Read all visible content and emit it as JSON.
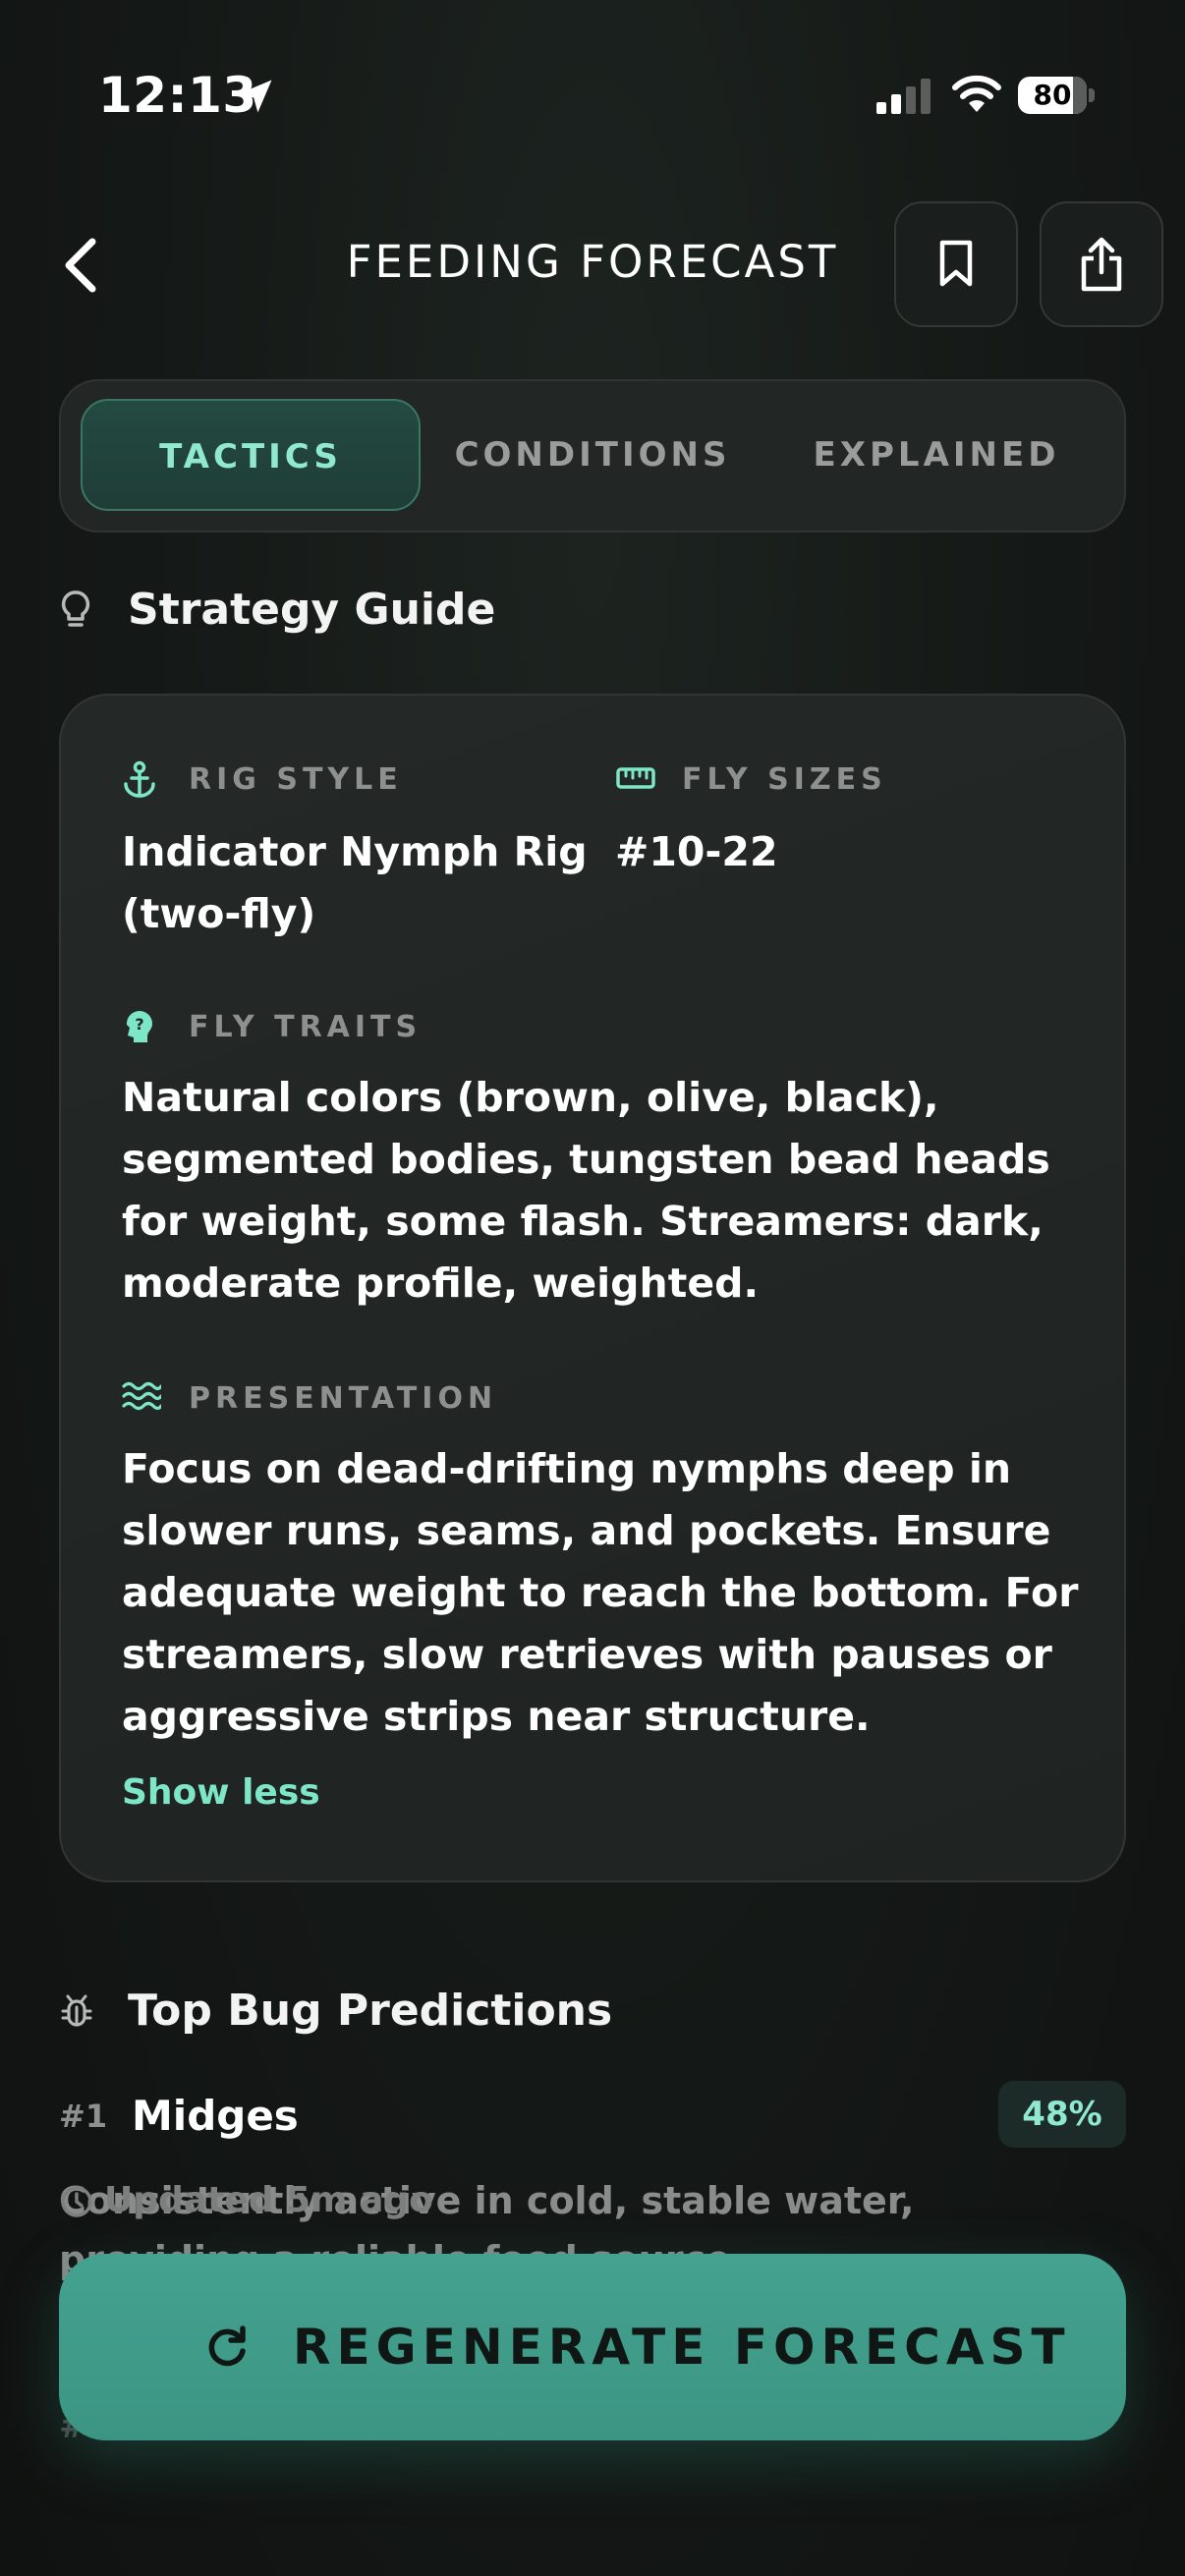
{
  "status_bar": {
    "time": "12:13",
    "battery": "80",
    "battery_level": 0.8
  },
  "header": {
    "title": "FEEDING FORECAST"
  },
  "tabs": [
    {
      "label": "TACTICS",
      "active": true
    },
    {
      "label": "CONDITIONS",
      "active": false
    },
    {
      "label": "EXPLAINED",
      "active": false
    }
  ],
  "strategy": {
    "title": "Strategy Guide",
    "rig_style_label": "RIG STYLE",
    "rig_style_value": "Indicator Nymph Rig (two-fly)",
    "fly_sizes_label": "FLY SIZES",
    "fly_sizes_value": "#10-22",
    "fly_traits_label": "FLY TRAITS",
    "fly_traits_value": "Natural colors (brown, olive, black), segmented bodies, tungsten bead heads for weight, some flash. Streamers: dark, moderate profile, weighted.",
    "presentation_label": "PRESENTATION",
    "presentation_value": "Focus on dead-drifting nymphs deep in slower runs, seams, and pockets. Ensure adequate weight to reach the bottom. For streamers, slow retrieves with pauses or aggressive strips near structure.",
    "show_less": "Show less"
  },
  "bugs": {
    "title": "Top Bug Predictions",
    "items": [
      {
        "rank": "#1",
        "name": "Midges",
        "percent": "48%",
        "description": "Consistently active in cold, stable water, providing a reliable food source."
      }
    ],
    "updated": "Updated 5m ago",
    "next_rank": "#2"
  },
  "regenerate": {
    "label": "REGENERATE FORECAST"
  },
  "colors": {
    "accent": "#7de6c7",
    "button": "#40998a"
  }
}
